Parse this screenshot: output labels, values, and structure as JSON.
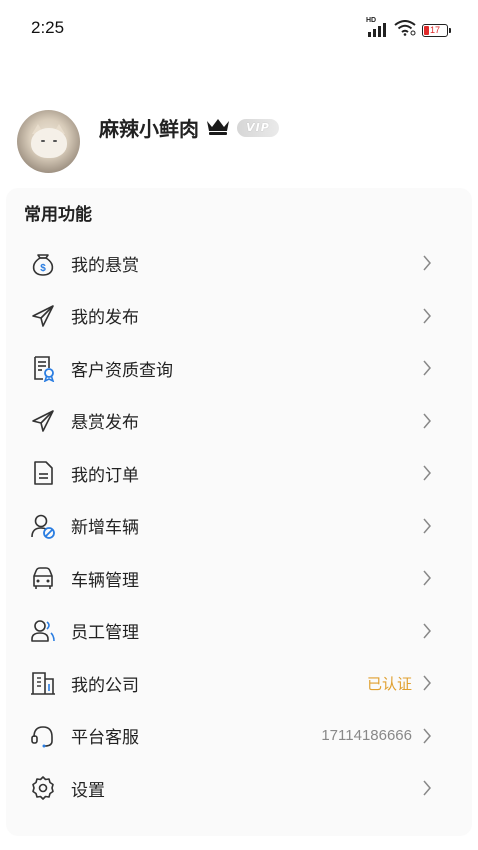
{
  "status_bar": {
    "time": "2:25",
    "network": "HD",
    "battery": "17",
    "battery_color": "#e02a2a"
  },
  "profile": {
    "username": "麻辣小鲜肉",
    "badge": "VIP"
  },
  "section": {
    "title": "常用功能"
  },
  "menu": [
    {
      "label": "我的悬赏",
      "icon": "money-bag-icon",
      "value": ""
    },
    {
      "label": "我的发布",
      "icon": "send-plane-icon",
      "value": ""
    },
    {
      "label": "客户资质查询",
      "icon": "certificate-search-icon",
      "value": ""
    },
    {
      "label": "悬赏发布",
      "icon": "send-plane-icon",
      "value": ""
    },
    {
      "label": "我的订单",
      "icon": "document-icon",
      "value": ""
    },
    {
      "label": "新增车辆",
      "icon": "user-add-icon",
      "value": ""
    },
    {
      "label": "车辆管理",
      "icon": "car-icon",
      "value": ""
    },
    {
      "label": "员工管理",
      "icon": "users-icon",
      "value": ""
    },
    {
      "label": "我的公司",
      "icon": "building-icon",
      "value": "已认证"
    },
    {
      "label": "平台客服",
      "icon": "headset-icon",
      "value": "17114186666"
    },
    {
      "label": "设置",
      "icon": "gear-icon",
      "value": ""
    }
  ],
  "colors": {
    "accent_verified": "#e0a030",
    "card_background": "#fafafa"
  }
}
